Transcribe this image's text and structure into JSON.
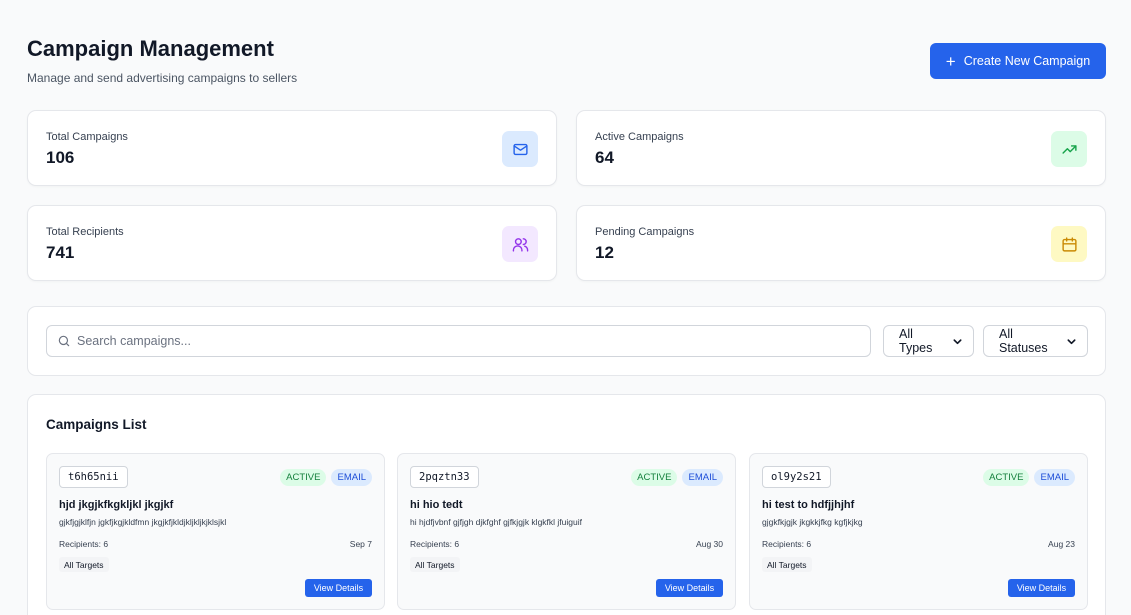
{
  "header": {
    "title": "Campaign Management",
    "subtitle": "Manage and send advertising campaigns to sellers",
    "create_label": "Create New Campaign"
  },
  "stats": [
    {
      "label": "Total Campaigns",
      "value": "106",
      "icon": "mail-icon",
      "color": "#2563eb"
    },
    {
      "label": "Active Campaigns",
      "value": "64",
      "icon": "trending-up-icon",
      "color": "#16a34a"
    },
    {
      "label": "Total Recipients",
      "value": "741",
      "icon": "users-icon",
      "color": "#9333ea"
    },
    {
      "label": "Pending Campaigns",
      "value": "12",
      "icon": "calendar-icon",
      "color": "#ca8a04"
    }
  ],
  "filters": {
    "search_placeholder": "Search campaigns...",
    "type_selected": "All Types",
    "status_selected": "All Statuses"
  },
  "campaigns_list": {
    "title": "Campaigns List",
    "items": [
      {
        "id": "t6h65nii",
        "status": "ACTIVE",
        "type": "EMAIL",
        "name": "hjd jkgjkfkgkljkl jkgjkf",
        "description": "gjkfjgjklfjn jgkfjkgjkldfmn jkgjkfjkldjkljkljkjklsjkl",
        "recipients": "Recipients: 6",
        "date": "Sep 7",
        "target": "All Targets",
        "action": "View Details"
      },
      {
        "id": "2pqztn33",
        "status": "ACTIVE",
        "type": "EMAIL",
        "name": "hi hio tedt",
        "description": "hi hjdfjvbnf gjfjgh djkfghf gjfkjgjk klgkfkl jfuiguif",
        "recipients": "Recipients: 6",
        "date": "Aug 30",
        "target": "All Targets",
        "action": "View Details"
      },
      {
        "id": "ol9y2s21",
        "status": "ACTIVE",
        "type": "EMAIL",
        "name": "hi test to hdfjjhjhf",
        "description": "gjgkfkjgjk jkgkkjfkg kgfjkjkg",
        "recipients": "Recipients: 6",
        "date": "Aug 23",
        "target": "All Targets",
        "action": "View Details"
      }
    ]
  }
}
